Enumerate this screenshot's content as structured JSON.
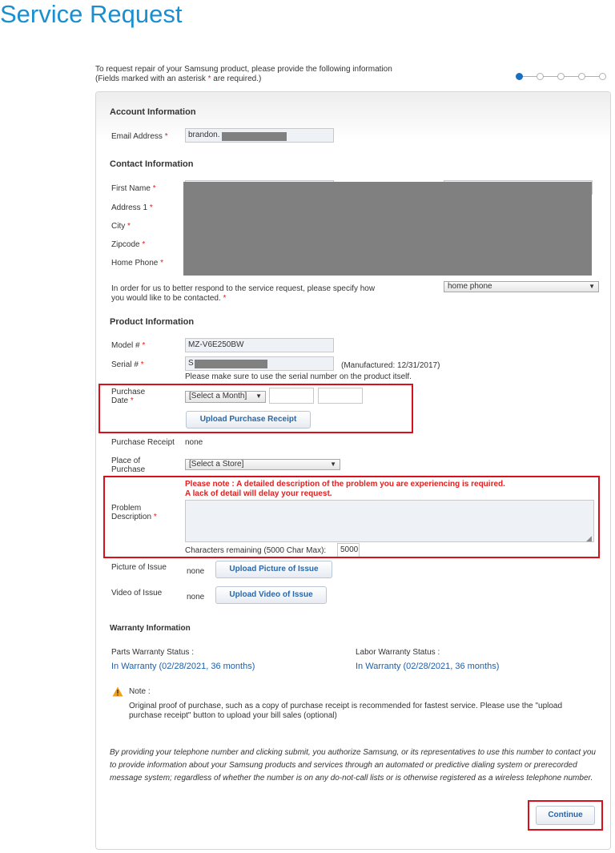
{
  "page_title": "Service Request",
  "intro": {
    "line1": "To request repair of your Samsung product, please provide the following information",
    "line2_pre": "(Fields marked with an asterisk ",
    "line2_star": "*",
    "line2_post": " are required.)"
  },
  "steps": {
    "total": 5,
    "active": 1
  },
  "required_marker": "*",
  "account": {
    "heading": "Account Information",
    "email_label": "Email Address",
    "email_value": "brandon."
  },
  "contact": {
    "heading": "Contact Information",
    "first_name_label": "First Name",
    "address1_label": "Address 1",
    "city_label": "City",
    "zipcode_label": "Zipcode",
    "home_phone_label": "Home Phone",
    "contact_pref_text": "In order for us to better respond to the service request, please specify how you would like to be contacted.",
    "contact_pref_value": "home phone"
  },
  "product": {
    "heading": "Product Information",
    "model_label": "Model #",
    "model_value": "MZ-V6E250BW",
    "serial_label": "Serial #",
    "serial_value": "S",
    "manufactured": "(Manufactured: 12/31/2017)",
    "serial_note": "Please make sure to use the serial number on the product itself.",
    "purchase_date_label_1": "Purchase",
    "purchase_date_label_2": "Date",
    "month_select": "[Select a Month]",
    "upload_receipt_button": "Upload Purchase Receipt",
    "receipt_label": "Purchase Receipt",
    "receipt_value": "none",
    "place_label_1": "Place of",
    "place_label_2": "Purchase",
    "store_select": "[Select a Store]",
    "note_line1": "Please note : A detailed description of the problem you are experiencing is required.",
    "note_line2": "A lack of detail will delay your request.",
    "problem_label_1": "Problem",
    "problem_label_2": "Description",
    "chars_remaining_label": "Characters remaining (5000 Char Max):",
    "chars_remaining_value": "5000",
    "picture_label": "Picture of Issue",
    "picture_value": "none",
    "upload_picture_button": "Upload Picture of Issue",
    "video_label": "Video of Issue",
    "video_value": "none",
    "upload_video_button": "Upload Video of Issue"
  },
  "warranty": {
    "heading": "Warranty Information",
    "parts_label": "Parts Warranty Status :",
    "parts_value": "In Warranty (02/28/2021, 36 months)",
    "labor_label": "Labor Warranty Status :",
    "labor_value": "In Warranty (02/28/2021, 36 months)"
  },
  "note": {
    "title": "Note :",
    "text": "Original proof of purchase, such as a copy of purchase receipt is recommended for fastest service. Please use the \"upload purchase receipt\" button to upload your bill sales (optional)"
  },
  "disclaimer": "By providing your telephone number and clicking submit, you authorize Samsung, or its representatives to use this number to contact you to provide information about your Samsung products and services through an automated or predictive dialing system or prerecorded message system; regardless of whether the number is on any do-not-call lists or is otherwise registered as a wireless telephone number.",
  "continue_button": "Continue",
  "colors": {
    "accent": "#1a8fd0",
    "link": "#1f5fa8",
    "required": "#e02020",
    "highlight": "#d8101c"
  }
}
